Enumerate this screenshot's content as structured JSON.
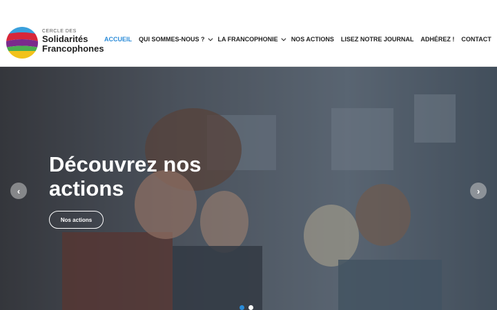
{
  "logo": {
    "small_text": "CERCLE DES",
    "line1": "Solidarités",
    "line2": "Francophones"
  },
  "nav": {
    "items": [
      {
        "label": "ACCUEIL",
        "active": true
      },
      {
        "label": "QUI SOMMES-NOUS ?",
        "dropdown": true
      },
      {
        "label": "LA FRANCOPHONIE",
        "dropdown": true
      },
      {
        "label": "NOS ACTIONS"
      },
      {
        "label": "LISEZ NOTRE JOURNAL"
      },
      {
        "label": "ADHÉREZ !"
      },
      {
        "label": "CONTACT"
      }
    ]
  },
  "hero": {
    "title_line1": "Découvrez nos",
    "title_line2": "actions",
    "button_label": "Nos actions",
    "prev_icon": "‹",
    "next_icon": "›"
  },
  "colors": {
    "accent": "#2a8bd8"
  }
}
